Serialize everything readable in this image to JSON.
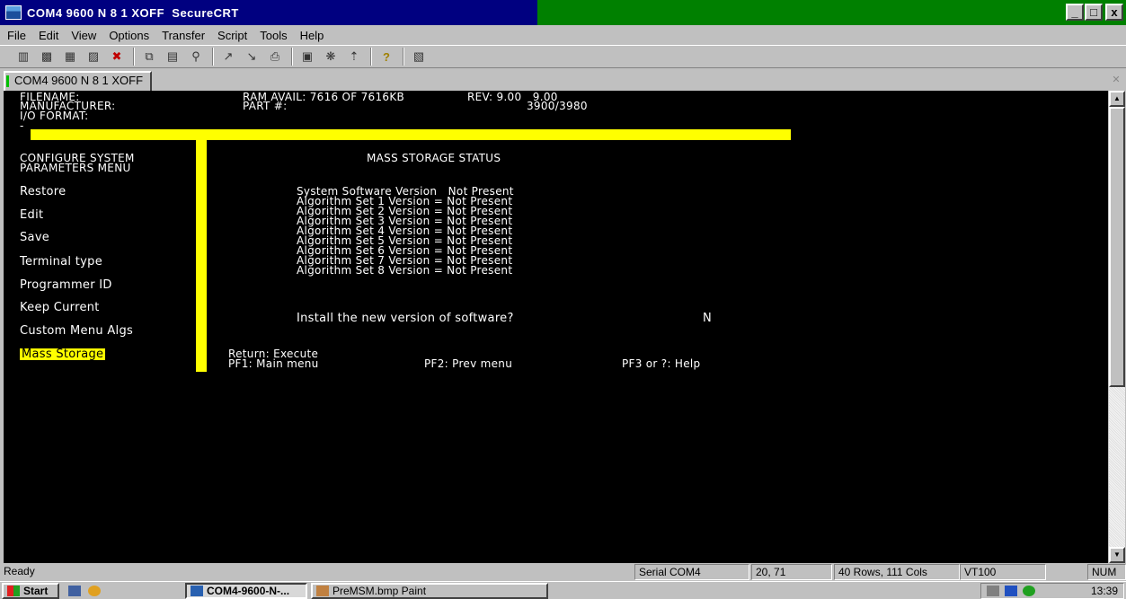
{
  "window": {
    "title": "COM4 9600 N 8 1 XOFF  SecureCRT",
    "controls": [
      "_",
      "□",
      "x"
    ]
  },
  "menu": [
    "File",
    "Edit",
    "View",
    "Options",
    "Transfer",
    "Script",
    "Tools",
    "Help"
  ],
  "toolbar_icons": [
    "connect-icon",
    "quick-connect-icon",
    "connect-tab-icon",
    "reconnect-icon",
    "disconnect-icon",
    "copy-icon",
    "paste-icon",
    "find-icon",
    "send-icon",
    "receive-icon",
    "print-icon",
    "session-options-icon",
    "global-options-icon",
    "keymap-icon",
    "help-icon",
    "terminal-icon"
  ],
  "session_tab": {
    "label": "COM4 9600 N 8 1 XOFF"
  },
  "terminal": {
    "header": {
      "filename_label": "FILENAME:",
      "manufacturer_label": "MANUFACTURER:",
      "io_format_label": "I/O FORMAT:",
      "ram_label": "RAM AVAIL: 7616 OF 7616KB",
      "part_label": "PART #:",
      "rev_label": "REV: 9.00   9.00",
      "part_value": "3900/3980",
      "cursor_line": "-"
    },
    "menu_title_1": "CONFIGURE SYSTEM",
    "menu_title_2": "PARAMETERS MENU",
    "menu_items": [
      "Restore",
      "Edit",
      "Save",
      "Terminal type",
      "Programmer ID",
      "Keep Current",
      "Custom Menu Algs",
      "Mass Storage"
    ],
    "selected_item": "Mass Storage",
    "panel_title": "MASS STORAGE STATUS",
    "status_lines": [
      "System Software Version   Not Present",
      "Algorithm Set 1 Version = Not Present",
      "Algorithm Set 2 Version = Not Present",
      "Algorithm Set 3 Version = Not Present",
      "Algorithm Set 4 Version = Not Present",
      "Algorithm Set 5 Version = Not Present",
      "Algorithm Set 6 Version = Not Present",
      "Algorithm Set 7 Version = Not Present",
      "Algorithm Set 8 Version = Not Present"
    ],
    "install_prompt": "Install the new version of software?",
    "install_answer": "N",
    "footer_line_1": "Return: Execute",
    "footer_pf1": "PF1: Main menu",
    "footer_pf2": "PF2: Prev menu",
    "footer_pf3": "PF3 or ?: Help",
    "colors": {
      "background": "#000000",
      "text": "#ffffff",
      "accent": "#ffff00"
    }
  },
  "statusbar": {
    "ready": "Ready",
    "connection": "Serial COM4",
    "cursor": "20, 71",
    "size": "40 Rows, 111 Cols",
    "emulation": "VT100",
    "num": "NUM"
  },
  "taskbar": {
    "start": "Start",
    "tasks": [
      "COM4-9600-N-...",
      "PreMSM.bmp  Paint"
    ],
    "clock": "13:39"
  }
}
